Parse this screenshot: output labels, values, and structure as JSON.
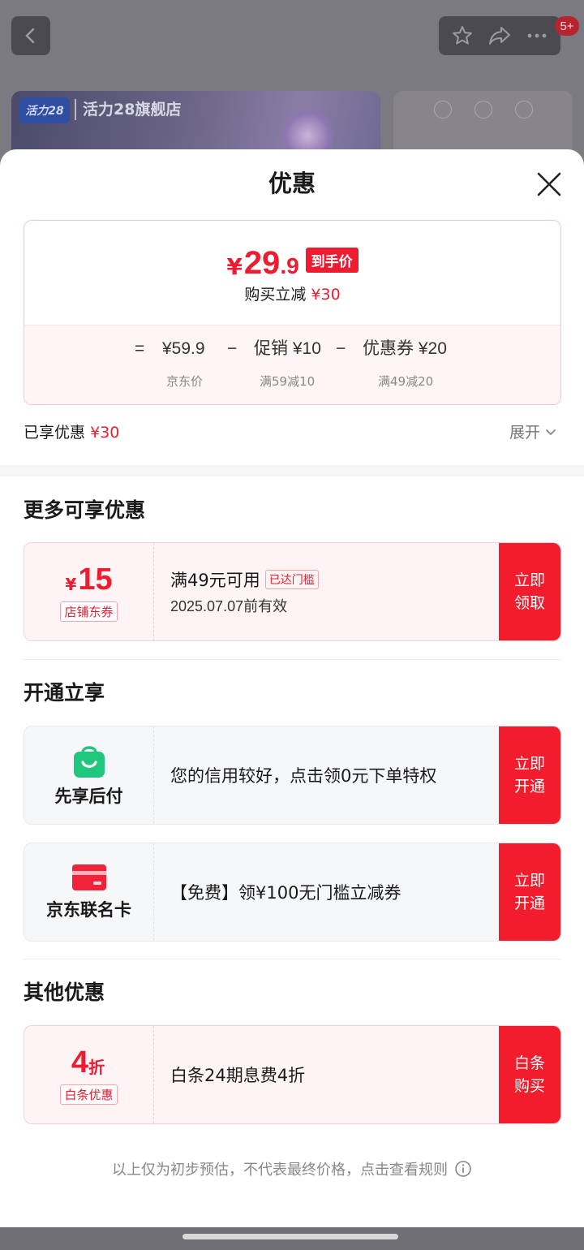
{
  "background": {
    "store_name": "活力28旗舰店",
    "store_logo_text": "活力28",
    "notification_badge": "5+"
  },
  "sheet": {
    "title": "优惠",
    "price": {
      "currency": "¥",
      "integer": "29",
      "decimal": ".9",
      "tag": "到手价",
      "sub_label": "购买立减",
      "sub_value": "¥30",
      "breakdown": {
        "equals": "=",
        "jd_price": "¥59.9",
        "jd_price_caption": "京东价",
        "minus1": "−",
        "promo": "促销 ¥10",
        "promo_caption": "满59减10",
        "minus2": "−",
        "coupon": "优惠券 ¥20",
        "coupon_caption": "满49减20"
      }
    },
    "enjoyed": {
      "label": "已享优惠",
      "value": "¥30",
      "expand_label": "展开"
    },
    "sections": {
      "more": {
        "title": "更多可享优惠",
        "coupon": {
          "currency": "¥",
          "amount": "15",
          "type_tag": "店铺东券",
          "condition": "满49元可用",
          "status_tag": "已达门槛",
          "validity": "2025.07.07前有效",
          "button_line1": "立即",
          "button_line2": "领取"
        }
      },
      "open": {
        "title": "开通立享",
        "items": [
          {
            "label": "先享后付",
            "icon": "shopping-bag-icon",
            "desc": "您的信用较好，点击领0元下单特权",
            "button_line1": "立即",
            "button_line2": "开通"
          },
          {
            "label": "京东联名卡",
            "icon": "credit-card-icon",
            "desc": "【免费】领¥100无门槛立减券",
            "button_line1": "立即",
            "button_line2": "开通"
          }
        ]
      },
      "other": {
        "title": "其他优惠",
        "baitiao": {
          "discount_num": "4",
          "discount_unit": "折",
          "type_tag": "白条优惠",
          "desc": "白条24期息费4折",
          "button_line1": "白条",
          "button_line2": "购买"
        }
      }
    },
    "footer_note": "以上仅为初步预估，不代表最终价格，点击查看规则"
  },
  "colors": {
    "accent_red": "#ee1c30",
    "button_red": "#f21c2c",
    "bag_green": "#1fc67b"
  }
}
